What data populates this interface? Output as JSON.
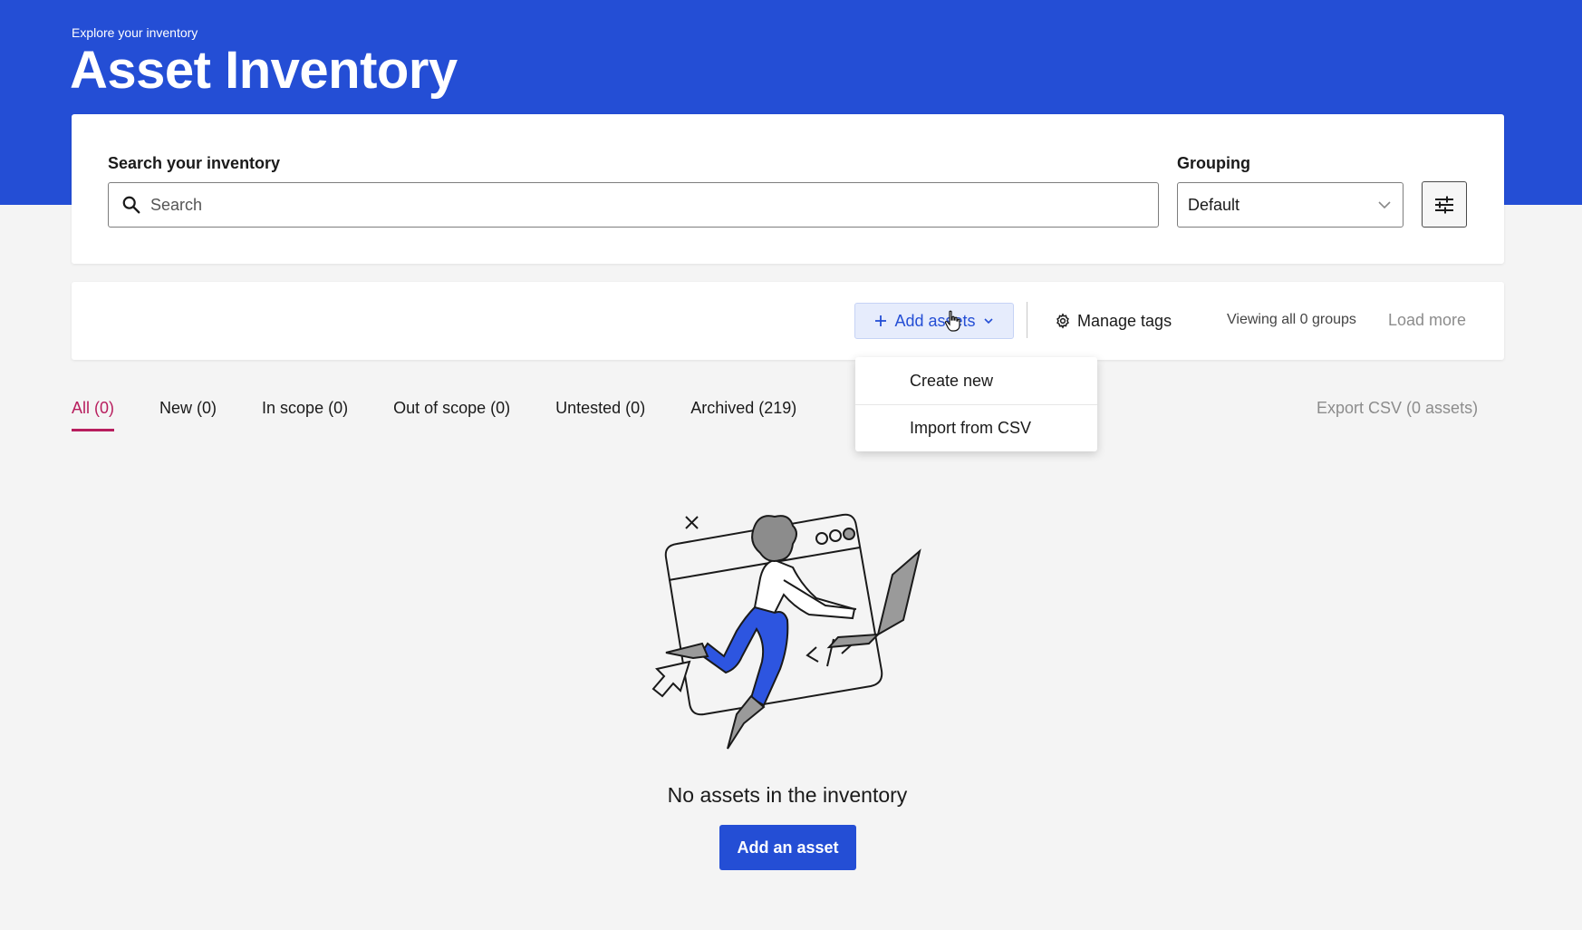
{
  "header": {
    "eyebrow": "Explore your inventory",
    "title": "Asset Inventory"
  },
  "search": {
    "label": "Search your inventory",
    "placeholder": "Search",
    "value": ""
  },
  "grouping": {
    "label": "Grouping",
    "selected": "Default"
  },
  "toolbar": {
    "add_assets_label": "Add assets",
    "manage_tags_label": "Manage tags",
    "viewing_text": "Viewing all 0 groups",
    "load_more_label": "Load more"
  },
  "add_assets_menu": {
    "items": [
      {
        "label": "Create new"
      },
      {
        "label": "Import from CSV"
      }
    ]
  },
  "tabs": [
    {
      "label": "All (0)",
      "active": true
    },
    {
      "label": "New (0)"
    },
    {
      "label": "In scope (0)"
    },
    {
      "label": "Out of scope (0)"
    },
    {
      "label": "Untested (0)"
    },
    {
      "label": "Archived (219)"
    }
  ],
  "export_label": "Export CSV (0 assets)",
  "empty_state": {
    "title": "No assets in the inventory",
    "button_label": "Add an asset"
  },
  "colors": {
    "brand": "#244ed5",
    "active_tab": "#b81e5e",
    "background": "#f4f4f4"
  },
  "icons": {
    "search": "search-icon",
    "dropdown": "chevron-down-icon",
    "filter": "sliders-icon",
    "add": "plus-icon",
    "tags": "gear-icon"
  }
}
